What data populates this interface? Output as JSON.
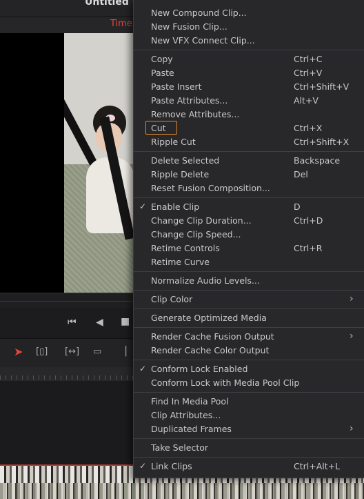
{
  "app": {
    "project_title": "Untitled Project",
    "page_tab": "Timeline"
  },
  "colors": {
    "accent": "#e8443a",
    "highlight": "#e58a2b",
    "menu_bg": "#28282b",
    "text": "#c9c9c9"
  },
  "transport": {
    "icons": [
      "skip-to-start-icon",
      "play-reverse-icon",
      "stop-icon"
    ]
  },
  "toolbar": {
    "icons": [
      "selection-arrow-icon",
      "trim-edit-icon",
      "dynamic-trim-icon",
      "blade-icon",
      "snap-icon"
    ]
  },
  "context_menu": {
    "groups": [
      {
        "items": [
          {
            "label": "New Compound Clip...",
            "shortcut": ""
          },
          {
            "label": "New Fusion Clip...",
            "shortcut": ""
          },
          {
            "label": "New VFX Connect Clip...",
            "shortcut": ""
          }
        ]
      },
      {
        "items": [
          {
            "label": "Copy",
            "shortcut": "Ctrl+C"
          },
          {
            "label": "Paste",
            "shortcut": "Ctrl+V"
          },
          {
            "label": "Paste Insert",
            "shortcut": "Ctrl+Shift+V"
          },
          {
            "label": "Paste Attributes...",
            "shortcut": "Alt+V"
          },
          {
            "label": "Remove Attributes...",
            "shortcut": ""
          },
          {
            "label": "Cut",
            "shortcut": "Ctrl+X",
            "highlighted": true
          },
          {
            "label": "Ripple Cut",
            "shortcut": "Ctrl+Shift+X"
          }
        ]
      },
      {
        "items": [
          {
            "label": "Delete Selected",
            "shortcut": "Backspace"
          },
          {
            "label": "Ripple Delete",
            "shortcut": "Del"
          },
          {
            "label": "Reset Fusion Composition...",
            "shortcut": ""
          }
        ]
      },
      {
        "items": [
          {
            "label": "Enable Clip",
            "shortcut": "D",
            "checked": true
          },
          {
            "label": "Change Clip Duration...",
            "shortcut": "Ctrl+D"
          },
          {
            "label": "Change Clip Speed...",
            "shortcut": ""
          },
          {
            "label": "Retime Controls",
            "shortcut": "Ctrl+R"
          },
          {
            "label": "Retime Curve",
            "shortcut": ""
          }
        ]
      },
      {
        "items": [
          {
            "label": "Normalize Audio Levels...",
            "shortcut": ""
          }
        ]
      },
      {
        "items": [
          {
            "label": "Clip Color",
            "shortcut": "",
            "submenu": true
          }
        ]
      },
      {
        "items": [
          {
            "label": "Generate Optimized Media",
            "shortcut": ""
          }
        ]
      },
      {
        "items": [
          {
            "label": "Render Cache Fusion Output",
            "shortcut": "",
            "submenu": true
          },
          {
            "label": "Render Cache Color Output",
            "shortcut": ""
          }
        ]
      },
      {
        "items": [
          {
            "label": "Conform Lock Enabled",
            "shortcut": "",
            "checked": true
          },
          {
            "label": "Conform Lock with Media Pool Clip",
            "shortcut": ""
          }
        ]
      },
      {
        "items": [
          {
            "label": "Find In Media Pool",
            "shortcut": ""
          },
          {
            "label": "Clip Attributes...",
            "shortcut": ""
          },
          {
            "label": "Duplicated Frames",
            "shortcut": "",
            "submenu": true
          }
        ]
      },
      {
        "items": [
          {
            "label": "Take Selector",
            "shortcut": ""
          }
        ]
      },
      {
        "items": [
          {
            "label": "Link Clips",
            "shortcut": "Ctrl+Alt+L",
            "checked": true
          }
        ]
      }
    ]
  }
}
